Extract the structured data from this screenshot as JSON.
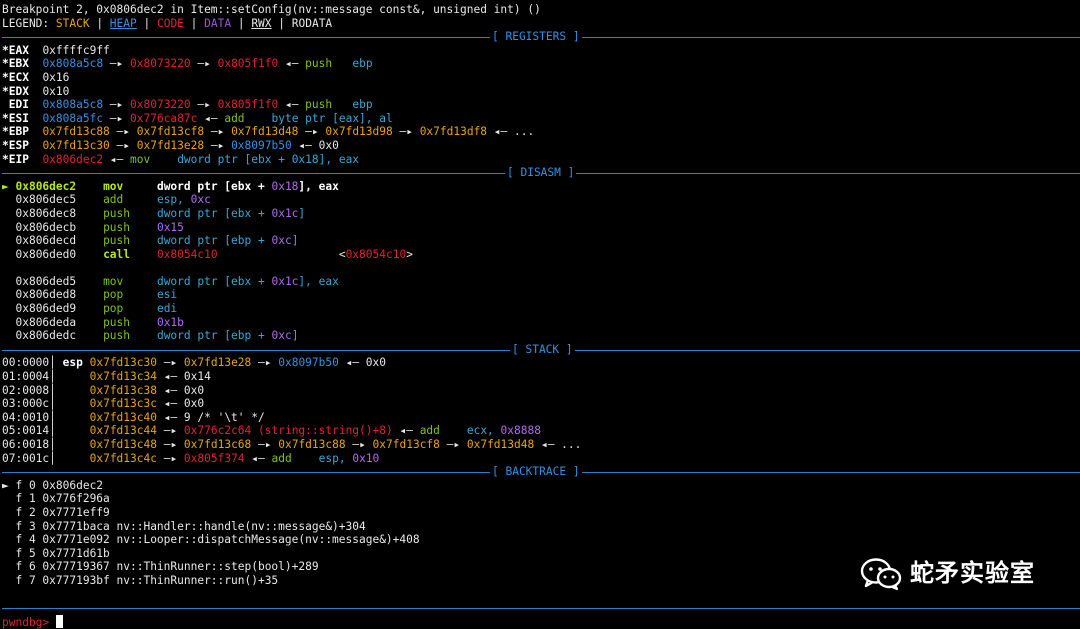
{
  "header": {
    "breakpoint": "Breakpoint 2, 0x0806dec2 in Item::setConfig(nv::message const&, unsigned int) ()",
    "legend_prefix": "LEGEND: ",
    "legend_stack": "STACK",
    "legend_heap": "HEAP",
    "legend_code": "CODE",
    "legend_data": "DATA",
    "legend_rwx": "RWX",
    "legend_rodata": "RODATA",
    "legend_sep": " | "
  },
  "sections": {
    "registers": "[ REGISTERS ]",
    "disasm": "[ DISASM ]",
    "stack": "[ STACK ]",
    "backtrace": "[ BACKTRACE ]"
  },
  "registers": {
    "eax": {
      "name": "*EAX",
      "value": "0xffffc9ff"
    },
    "ebx": {
      "name": "*EBX",
      "v1": "0x808a5c8",
      "v2": "0x8073220",
      "v3": "0x805f1f0",
      "ins": "push",
      "op": "ebp"
    },
    "ecx": {
      "name": "*ECX",
      "value": "0x16"
    },
    "edx": {
      "name": "*EDX",
      "value": "0x10"
    },
    "edi": {
      "name": " EDI",
      "v1": "0x808a5c8",
      "v2": "0x8073220",
      "v3": "0x805f1f0",
      "ins": "push",
      "op": "ebp"
    },
    "esi": {
      "name": "*ESI",
      "v1": "0x808a5fc",
      "v2": "0x776ca87c",
      "ins": "add",
      "op": "byte ptr [eax], al"
    },
    "ebp": {
      "name": "*EBP",
      "v1": "0x7fd13c88",
      "v2": "0x7fd13cf8",
      "v3": "0x7fd13d48",
      "v4": "0x7fd13d98",
      "v5": "0x7fd13df8",
      "tail": "..."
    },
    "esp": {
      "name": "*ESP",
      "v1": "0x7fd13c30",
      "v2": "0x7fd13e28",
      "v3": "0x8097b50",
      "v4": "0x0"
    },
    "eip": {
      "name": "*EIP",
      "v1": "0x806dec2",
      "ins": "mov",
      "op": "dword ptr [ebx + 0x18], eax"
    }
  },
  "disasm": [
    {
      "marker": "►",
      "addr": "0x806dec2",
      "mn": "mov",
      "op_a": "dword ptr [ebx + ",
      "op_n": "0x18",
      "op_b": "], eax",
      "current": true
    },
    {
      "marker": " ",
      "addr": "0x806dec5",
      "mn": "add",
      "op_a": "esp, ",
      "op_n": "0xc",
      "op_b": ""
    },
    {
      "marker": " ",
      "addr": "0x806dec8",
      "mn": "push",
      "op_a": "dword ptr [ebx + ",
      "op_n": "0x1c",
      "op_b": "]"
    },
    {
      "marker": " ",
      "addr": "0x806decb",
      "mn": "push",
      "op_a": "",
      "op_n": "0x15",
      "op_b": ""
    },
    {
      "marker": " ",
      "addr": "0x806decd",
      "mn": "push",
      "op_a": "dword ptr [ebp + ",
      "op_n": "0xc",
      "op_b": "]"
    },
    {
      "marker": " ",
      "addr": "0x806ded0",
      "mn": "call",
      "target": "0x8054c10",
      "target2": "0x8054c10",
      "call": true
    },
    {
      "blank": true
    },
    {
      "marker": " ",
      "addr": "0x806ded5",
      "mn": "mov",
      "op_a": "dword ptr [ebx + ",
      "op_n": "0x1c",
      "op_b": "], eax"
    },
    {
      "marker": " ",
      "addr": "0x806ded8",
      "mn": "pop",
      "op_a": "esi",
      "op_n": "",
      "op_b": ""
    },
    {
      "marker": " ",
      "addr": "0x806ded9",
      "mn": "pop",
      "op_a": "edi",
      "op_n": "",
      "op_b": ""
    },
    {
      "marker": " ",
      "addr": "0x806deda",
      "mn": "push",
      "op_a": "",
      "op_n": "0x1b",
      "op_b": ""
    },
    {
      "marker": " ",
      "addr": "0x806dedc",
      "mn": "push",
      "op_a": "dword ptr [ebp + ",
      "op_n": "0xc",
      "op_b": "]"
    }
  ],
  "stack": [
    {
      "idx": "00:0000",
      "reg": "esp",
      "addr": "0x7fd13c30",
      "rest": [
        {
          "t": "arrow",
          "v": " —▸ "
        },
        {
          "t": "stack",
          "v": "0x7fd13e28"
        },
        {
          "t": "arrow",
          "v": " —▸ "
        },
        {
          "t": "heap",
          "v": "0x8097b50"
        },
        {
          "t": "w",
          "v": " ◂— 0x0"
        }
      ]
    },
    {
      "idx": "01:0004",
      "reg": "   ",
      "addr": "0x7fd13c34",
      "rest": [
        {
          "t": "w",
          "v": " ◂— 0x14"
        }
      ]
    },
    {
      "idx": "02:0008",
      "reg": "   ",
      "addr": "0x7fd13c38",
      "rest": [
        {
          "t": "w",
          "v": " ◂— 0x0"
        }
      ]
    },
    {
      "idx": "03:000c",
      "reg": "   ",
      "addr": "0x7fd13c3c",
      "rest": [
        {
          "t": "w",
          "v": " ◂— 0x0"
        }
      ]
    },
    {
      "idx": "04:0010",
      "reg": "   ",
      "addr": "0x7fd13c40",
      "rest": [
        {
          "t": "w",
          "v": " ◂— 9 /* '\\t' */"
        }
      ]
    },
    {
      "idx": "05:0014",
      "reg": "   ",
      "addr": "0x7fd13c44",
      "rest": [
        {
          "t": "arrow",
          "v": " —▸ "
        },
        {
          "t": "code",
          "v": "0x776c2c64 (string::string()+8)"
        },
        {
          "t": "w",
          "v": " ◂— "
        },
        {
          "t": "grn",
          "v": "add    "
        },
        {
          "t": "cy",
          "v": "ecx, "
        },
        {
          "t": "num",
          "v": "0x8888"
        }
      ]
    },
    {
      "idx": "06:0018",
      "reg": "   ",
      "addr": "0x7fd13c48",
      "rest": [
        {
          "t": "arrow",
          "v": " —▸ "
        },
        {
          "t": "stack",
          "v": "0x7fd13c68"
        },
        {
          "t": "arrow",
          "v": " —▸ "
        },
        {
          "t": "stack",
          "v": "0x7fd13c88"
        },
        {
          "t": "arrow",
          "v": " —▸ "
        },
        {
          "t": "stack",
          "v": "0x7fd13cf8"
        },
        {
          "t": "arrow",
          "v": " —▸ "
        },
        {
          "t": "stack",
          "v": "0x7fd13d48"
        },
        {
          "t": "w",
          "v": " ◂— ..."
        }
      ]
    },
    {
      "idx": "07:001c",
      "reg": "   ",
      "addr": "0x7fd13c4c",
      "rest": [
        {
          "t": "arrow",
          "v": " —▸ "
        },
        {
          "t": "code",
          "v": "0x805f374"
        },
        {
          "t": "w",
          "v": " ◂— "
        },
        {
          "t": "grn",
          "v": "add    "
        },
        {
          "t": "cy",
          "v": "esp, "
        },
        {
          "t": "num",
          "v": "0x10"
        }
      ]
    }
  ],
  "backtrace": [
    {
      "marker": "►",
      "text": "f 0 0x806dec2"
    },
    {
      "marker": " ",
      "text": "f 1 0x776f296a"
    },
    {
      "marker": " ",
      "text": "f 2 0x7771eff9"
    },
    {
      "marker": " ",
      "text": "f 3 0x7771baca nv::Handler::handle(nv::message&)+304"
    },
    {
      "marker": " ",
      "text": "f 4 0x7771e092 nv::Looper::dispatchMessage(nv::message&)+408"
    },
    {
      "marker": " ",
      "text": "f 5 0x7771d61b"
    },
    {
      "marker": " ",
      "text": "f 6 0x77719367 nv::ThinRunner::step(bool)+289"
    },
    {
      "marker": " ",
      "text": "f 7 0x777193bf nv::ThinRunner::run()+35"
    }
  ],
  "prompt": "pwndbg> ",
  "watermark": {
    "text": "蛇矛实验室",
    "icon": "wechat-icon"
  },
  "arrows": {
    "right": " —▸ ",
    "left": " ◂— "
  },
  "colors": {
    "stack": "#e8a21c",
    "heap": "#3a8fe0",
    "code": "#e0242c",
    "data": "#9a58d2",
    "separator": "#2d7fd1"
  }
}
